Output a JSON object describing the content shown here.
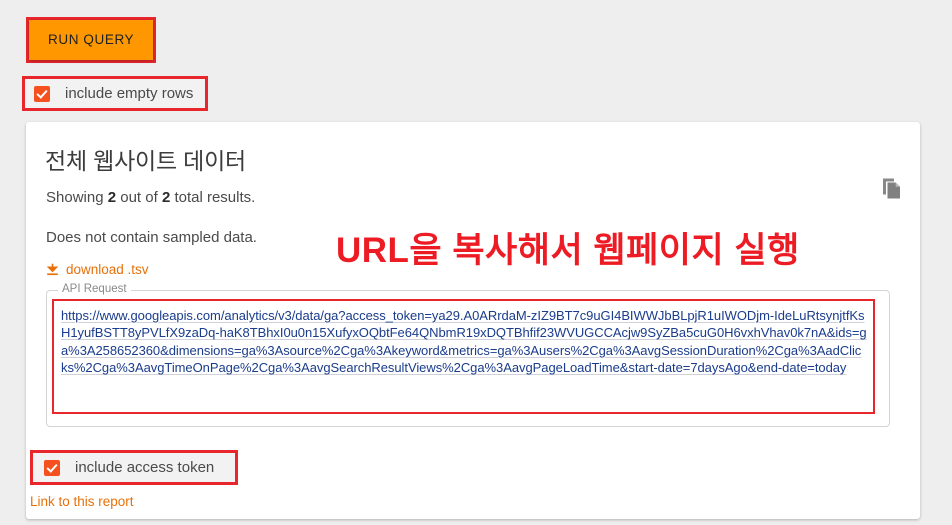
{
  "toolbar": {
    "run_query_label": "RUN QUERY"
  },
  "options": {
    "include_empty_rows": {
      "label": "include empty rows",
      "checked": true,
      "checkbox_color": "#f4511e"
    },
    "include_access_token": {
      "label": "include access token",
      "checked": true,
      "checkbox_color": "#f4511e"
    }
  },
  "card": {
    "title": "전체 웹사이트 데이터",
    "showing": {
      "prefix": "Showing ",
      "shown_count": "2",
      "middle": " out of ",
      "total_count": "2",
      "suffix": " total results."
    },
    "sampling_note": "Does not contain sampled data.",
    "download_link": "download .tsv",
    "download_icon": "download-icon",
    "api_request": {
      "legend": "API Request",
      "value": "https://www.googleapis.com/analytics/v3/data/ga?access_token=ya29.A0ARrdaM-zIZ9BT7c9uGI4BIWWJbBLpjR1uIWODjm-IdeLuRtsynjtfKsH1yufBSTT8yPVLfX9zaDq-haK8TBhxI0u0n15XufyxOQbtFe64QNbmR19xDQTBhfif23WVUGCCAcjw9SyZBa5cuG0H6vxhVhav0k7nA&ids=ga%3A258652360&dimensions=ga%3Asource%2Cga%3Akeyword&metrics=ga%3Ausers%2Cga%3AavgSessionDuration%2Cga%3AadClicks%2Cga%3AavgTimeOnPage%2Cga%3AavgSearchResultViews%2Cga%3AavgPageLoadTime&start-date=7daysAgo&end-date=today",
      "copy_icon": "copy-icon"
    },
    "report_link": "Link to this report"
  },
  "annotation": {
    "text": "URL을 복사해서 웹페이지 실행",
    "color": "#ed1c24"
  },
  "colors": {
    "accent_orange": "#ff9800",
    "link_orange": "#e8710a",
    "highlight_red": "#e8272c",
    "page_background": "#eeeeee",
    "card_background": "#ffffff",
    "url_text": "#1a3c8c"
  }
}
